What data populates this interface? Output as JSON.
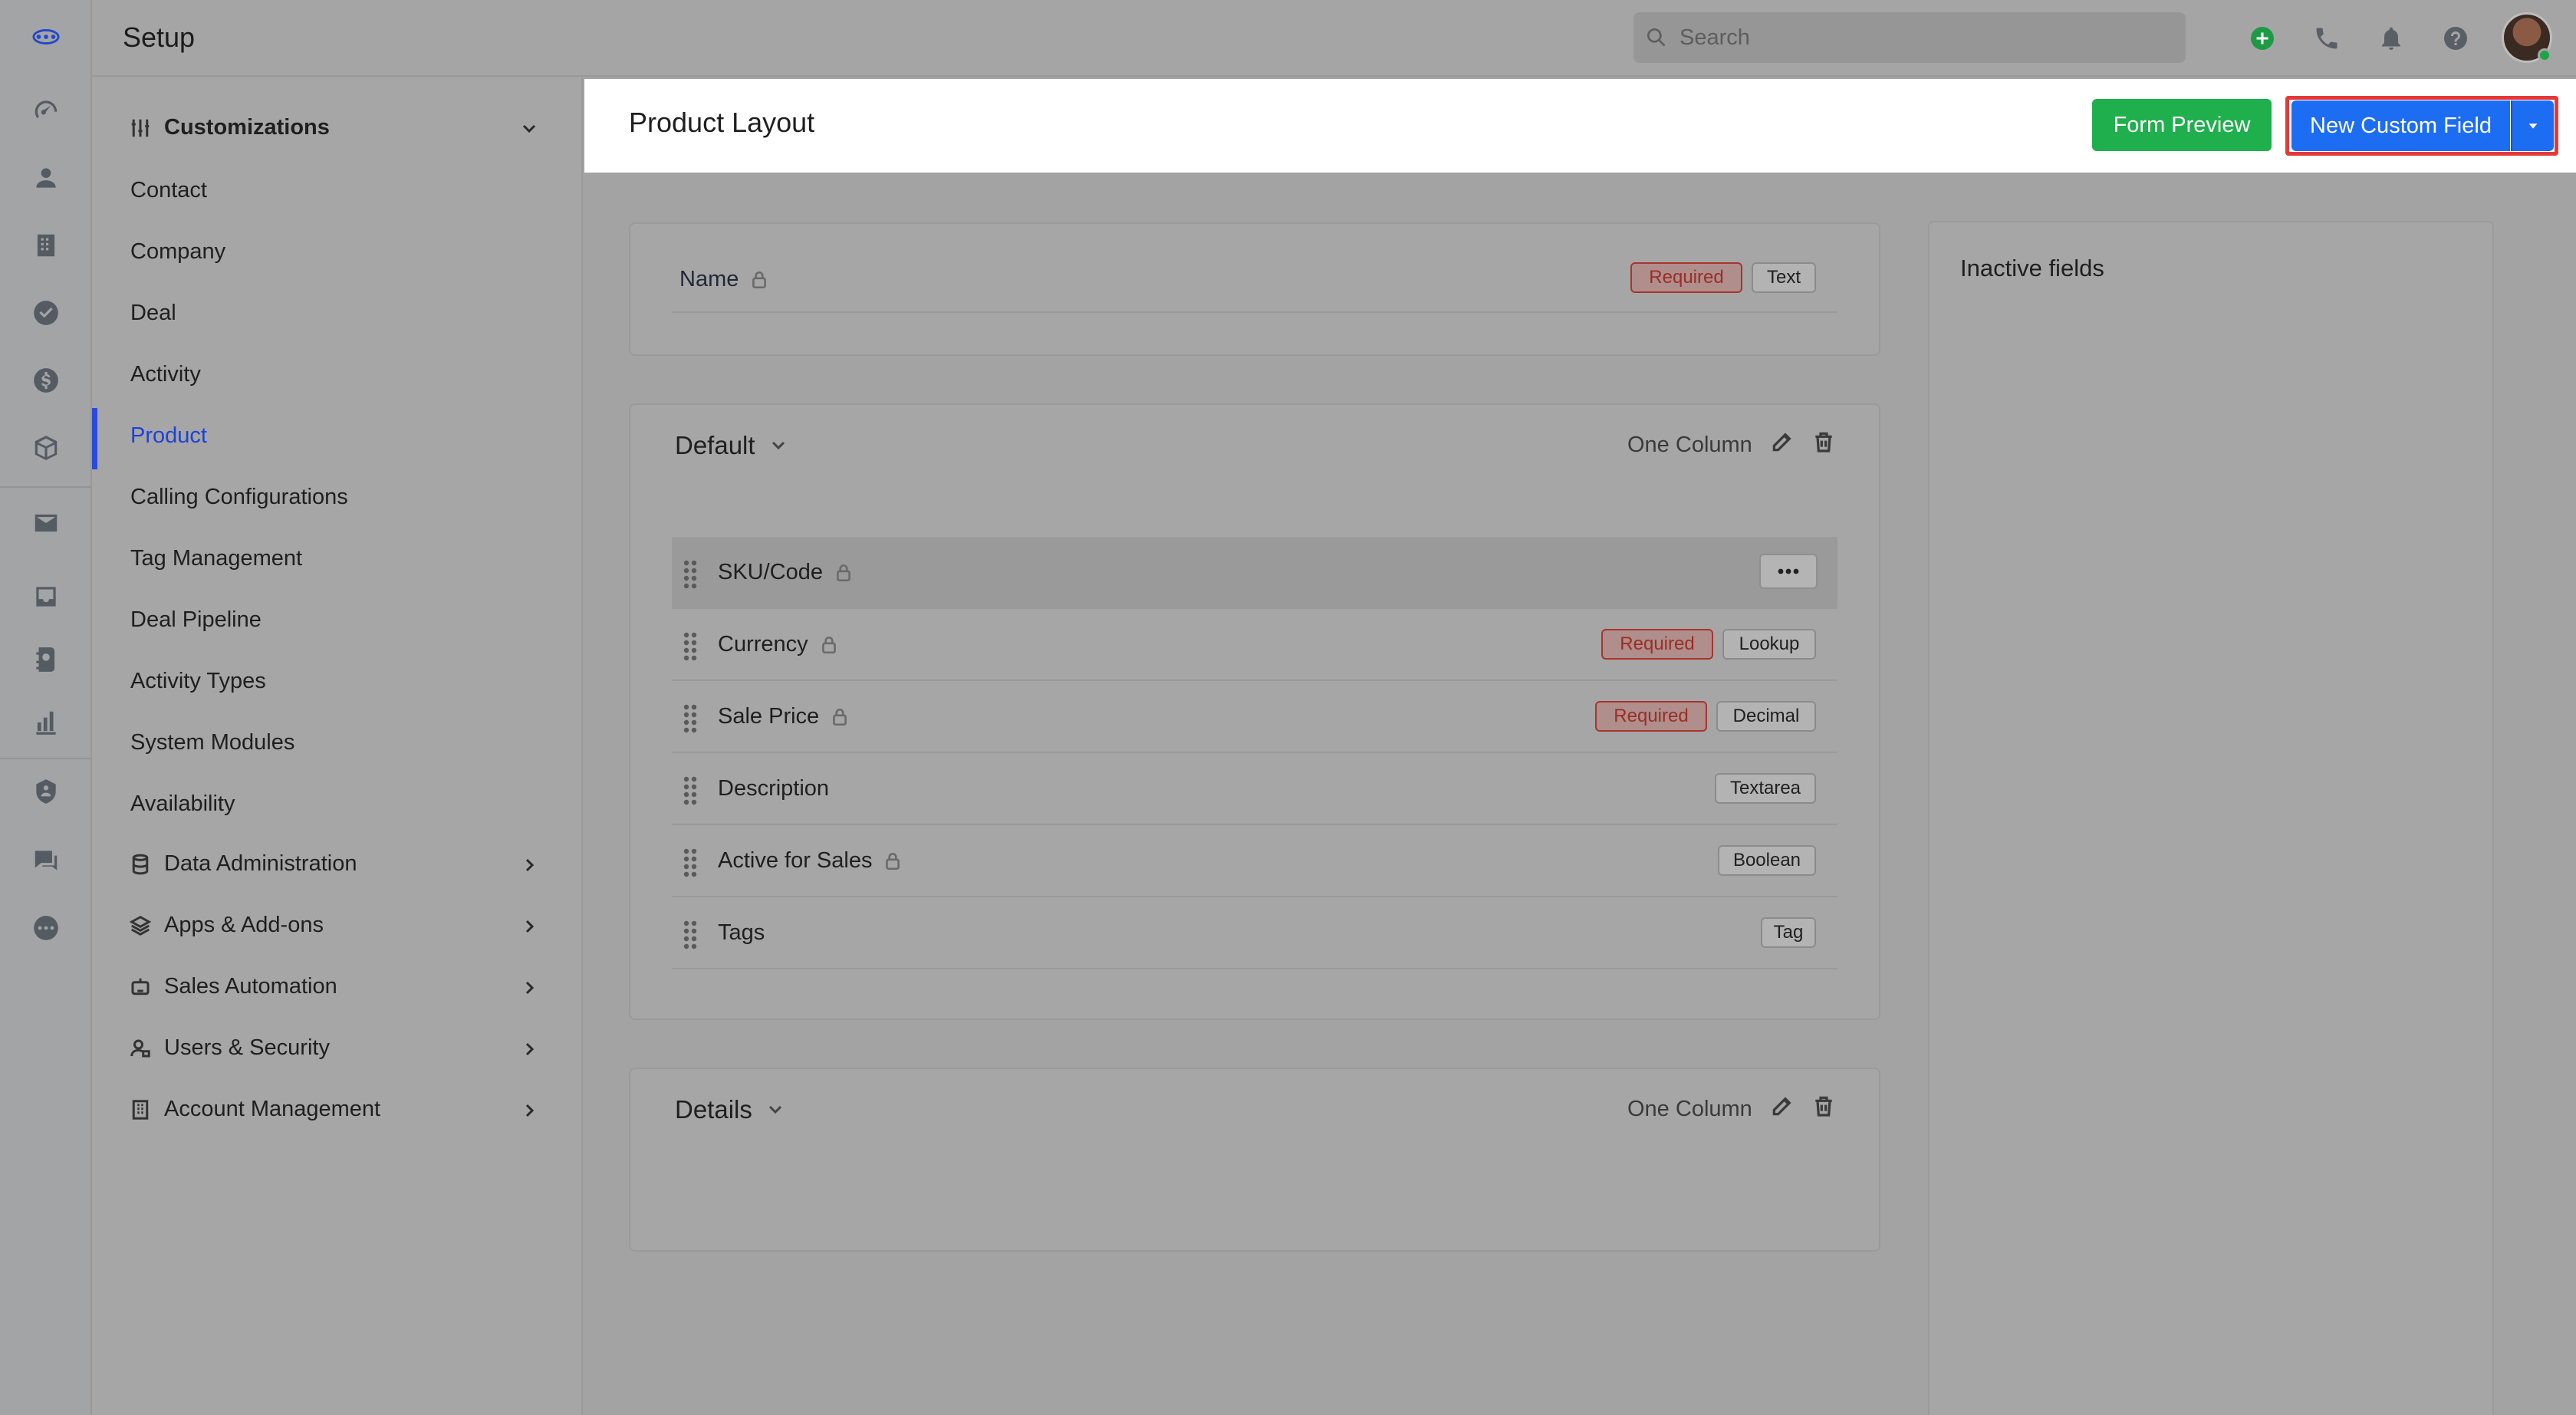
{
  "topbar": {
    "title": "Setup",
    "search_placeholder": "Search"
  },
  "sidebar": {
    "group_customizations": "Customizations",
    "items": [
      "Contact",
      "Company",
      "Deal",
      "Activity",
      "Product",
      "Calling Configurations",
      "Tag Management",
      "Deal Pipeline",
      "Activity Types",
      "System Modules",
      "Availability"
    ],
    "active_item": "Product",
    "groups": [
      "Data Administration",
      "Apps & Add-ons",
      "Sales Automation",
      "Users & Security",
      "Account Management"
    ]
  },
  "header": {
    "title": "Product Layout",
    "form_preview": "Form Preview",
    "new_custom_field": "New Custom Field"
  },
  "name_card": {
    "label": "Name",
    "required": "Required",
    "type": "Text"
  },
  "default_section": {
    "title": "Default",
    "layout": "One Column",
    "rows": [
      {
        "label": "SKU/Code",
        "locked": true,
        "required": "",
        "type": ""
      },
      {
        "label": "Currency",
        "locked": true,
        "required": "Required",
        "type": "Lookup"
      },
      {
        "label": "Sale Price",
        "locked": true,
        "required": "Required",
        "type": "Decimal"
      },
      {
        "label": "Description",
        "locked": false,
        "required": "",
        "type": "Textarea"
      },
      {
        "label": "Active for Sales",
        "locked": true,
        "required": "",
        "type": "Boolean"
      },
      {
        "label": "Tags",
        "locked": false,
        "required": "",
        "type": "Tag"
      }
    ]
  },
  "details_section": {
    "title": "Details",
    "layout": "One Column"
  },
  "inactive": {
    "title": "Inactive fields"
  },
  "colors": {
    "brand_blue": "#1d6df2",
    "brand_green": "#1faf4c",
    "required_red": "#9b2d27",
    "highlight_outline": "#e53939"
  }
}
